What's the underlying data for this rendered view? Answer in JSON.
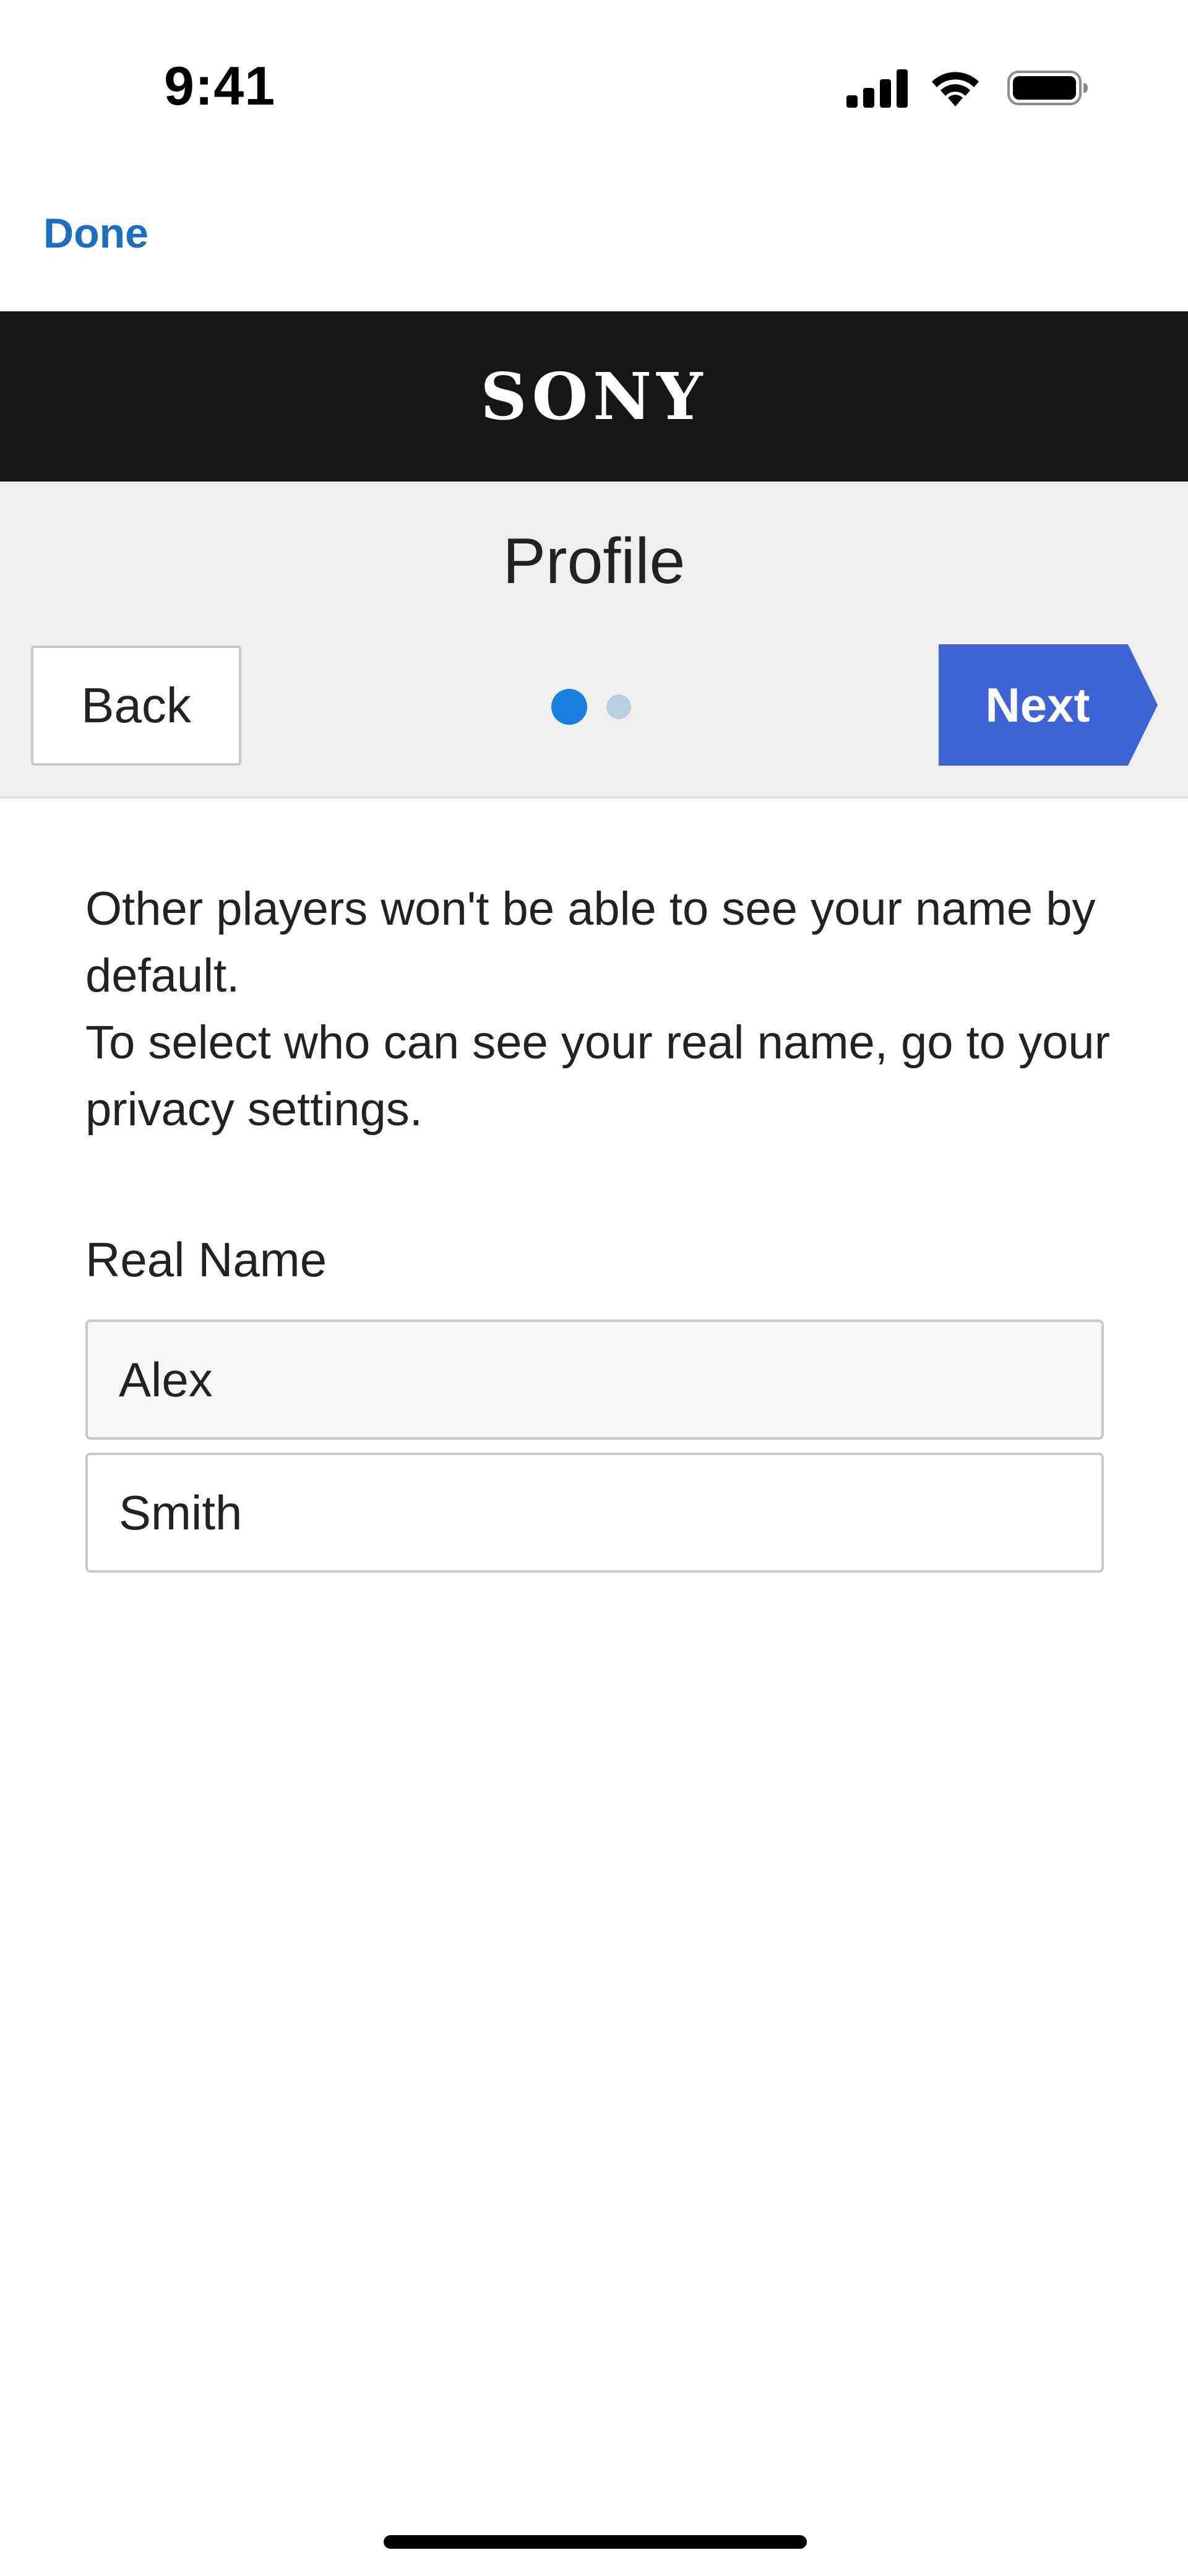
{
  "status_bar": {
    "time": "9:41",
    "icons": [
      "cellular-signal-icon",
      "wifi-icon",
      "battery-icon"
    ]
  },
  "nav": {
    "done_label": "Done"
  },
  "brand": {
    "logo_text": "SONY"
  },
  "header": {
    "title": "Profile",
    "back_label": "Back",
    "next_label": "Next",
    "steps": {
      "total": 2,
      "current": 1
    }
  },
  "content": {
    "info_line_1": "Other players won't be able to see your name by default.",
    "info_line_2": "To select who can see your real name, go to your privacy settings.",
    "real_name_label": "Real Name",
    "first_name_value": "Alex",
    "last_name_value": "Smith"
  },
  "colors": {
    "accent_link": "#1a6fc0",
    "next_button": "#3e63d6",
    "brand_bar": "#161616",
    "step_active": "#1a7fe0",
    "step_inactive": "#b9cfe0"
  }
}
